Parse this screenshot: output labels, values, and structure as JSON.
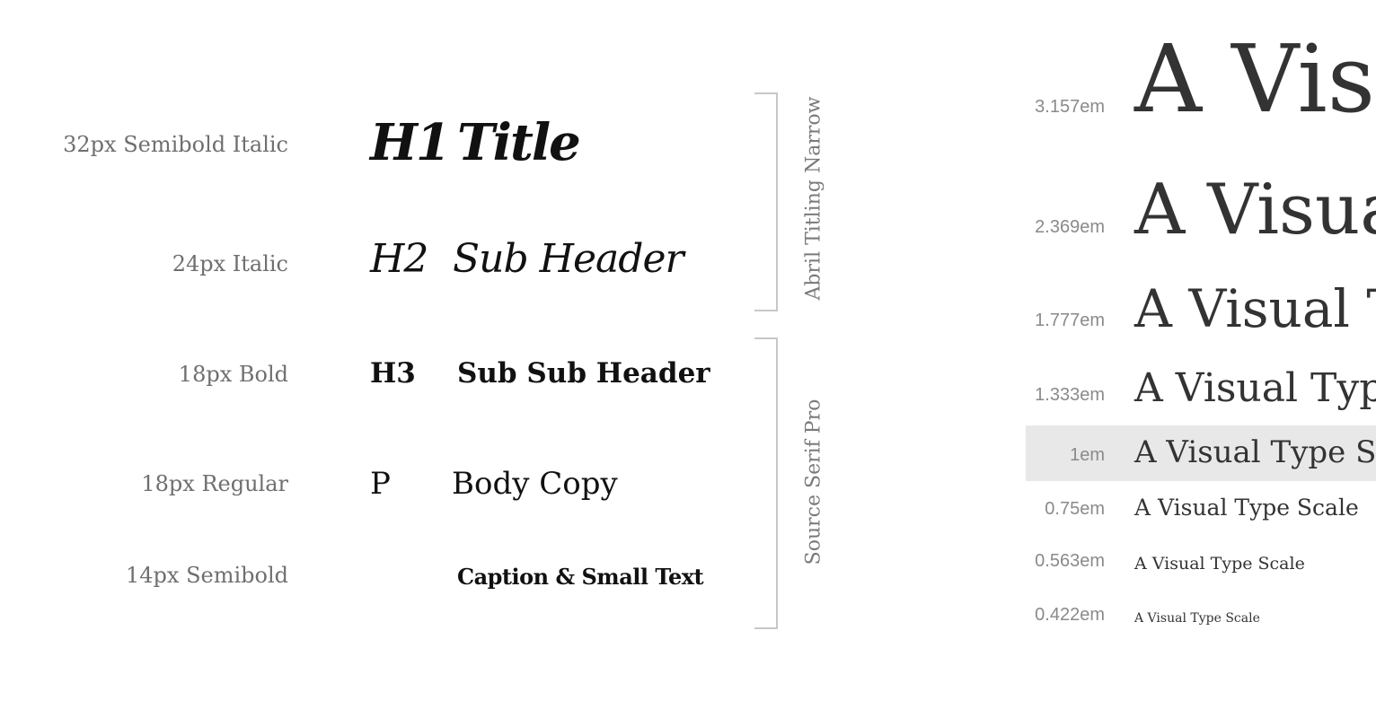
{
  "rows": [
    {
      "spec": "32px Semibold Italic",
      "tag": "H1",
      "sample": "Title"
    },
    {
      "spec": "24px Italic",
      "tag": "H2",
      "sample": "Sub Header"
    },
    {
      "spec": "18px  Bold",
      "tag": "H3",
      "sample": "Sub Sub Header"
    },
    {
      "spec": "18px  Regular",
      "tag": "P",
      "sample": "Body Copy"
    },
    {
      "spec": "14px  Semibold",
      "tag": "",
      "sample": "Caption & Small Text"
    }
  ],
  "fonts": {
    "heading": "Abril Titling Narrow",
    "body": "Source Serif Pro"
  },
  "scale": {
    "sample_text": "A Visual Type Scale",
    "items": [
      {
        "em": "3.157em"
      },
      {
        "em": "2.369em"
      },
      {
        "em": "1.777em"
      },
      {
        "em": "1.333em"
      },
      {
        "em": "1em",
        "highlighted": true
      },
      {
        "em": "0.75em"
      },
      {
        "em": "0.563em"
      },
      {
        "em": "0.422em"
      }
    ]
  },
  "colors": {
    "label_gray": "#6f6f6f",
    "bracket_gray": "#c7c7c7",
    "highlight_bg": "#e8e8e8",
    "text_dark": "#111111"
  }
}
